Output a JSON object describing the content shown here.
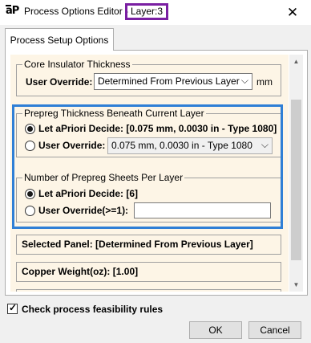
{
  "window": {
    "app_logo": "aP",
    "title": "Process Options Editor - ",
    "layer_label": "Layer:3",
    "close_glyph": "✕"
  },
  "tabs": [
    {
      "label": "Process Setup Options"
    }
  ],
  "core_insulator": {
    "group_title": "Core Insulator Thickness",
    "user_override_label": "User Override:",
    "selected_value": "Determined From Previous Layer",
    "unit": "mm"
  },
  "prepreg_thickness": {
    "group_title": "Prepreg Thickness Beneath Current Layer",
    "option_apriori": "Let aPriori Decide: [0.075 mm, 0.0030 in - Type 1080]",
    "option_override": "User Override:",
    "selected_value": "0.075 mm, 0.0030 in - Type 1080",
    "selected_option": "apriori"
  },
  "prepreg_sheets": {
    "group_title": "Number of Prepreg Sheets Per Layer",
    "option_apriori": "Let aPriori Decide: [6]",
    "option_override": "User Override(>=1):",
    "override_value": "",
    "selected_option": "apriori"
  },
  "selected_panel": "Selected Panel: [Determined From Previous Layer]",
  "copper_weight": "Copper Weight(oz): [1.00]",
  "feasibility": {
    "label": "Check process feasibility rules",
    "checked": true
  },
  "buttons": {
    "ok": "OK",
    "cancel": "Cancel"
  },
  "icons": {
    "chevron": "chevron-down-icon",
    "close": "close-icon",
    "check": "checkmark-icon"
  },
  "colors": {
    "highlight_blue": "#2f7fd6",
    "layer_border": "#7a1fa2",
    "panel_bg": "#fdf5e6"
  }
}
